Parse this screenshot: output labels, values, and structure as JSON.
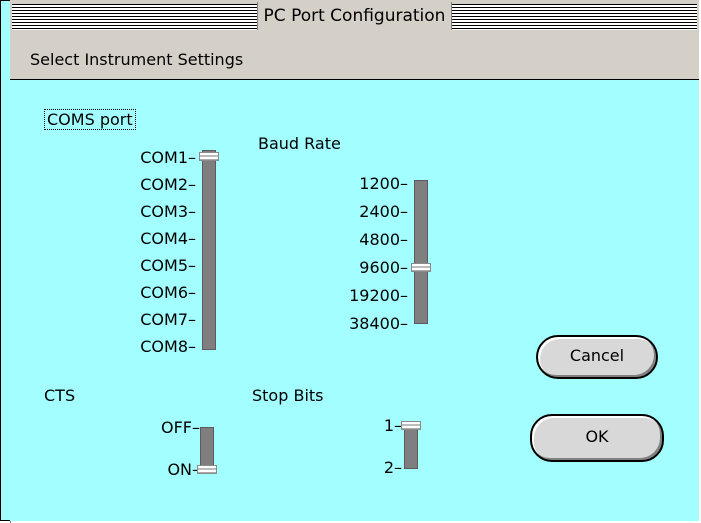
{
  "window": {
    "title": "PC Port Configuration"
  },
  "menubar": {
    "label": "Select Instrument Settings"
  },
  "coms_port": {
    "label": "COMS port",
    "options": [
      "COM1",
      "COM2",
      "COM3",
      "COM4",
      "COM5",
      "COM6",
      "COM7",
      "COM8"
    ],
    "selected": "COM1"
  },
  "baud_rate": {
    "label": "Baud Rate",
    "options": [
      "1200",
      "2400",
      "4800",
      "9600",
      "19200",
      "38400"
    ],
    "selected": "9600"
  },
  "cts": {
    "label": "CTS",
    "options": [
      "OFF",
      "ON"
    ],
    "selected": "ON"
  },
  "stop_bits": {
    "label": "Stop Bits",
    "options": [
      "1",
      "2"
    ],
    "selected": "1"
  },
  "buttons": {
    "cancel": "Cancel",
    "ok": "OK"
  },
  "colors": {
    "background": "#a3ffff",
    "track": "#7f7f7f",
    "chrome": "#d4d0c8"
  }
}
